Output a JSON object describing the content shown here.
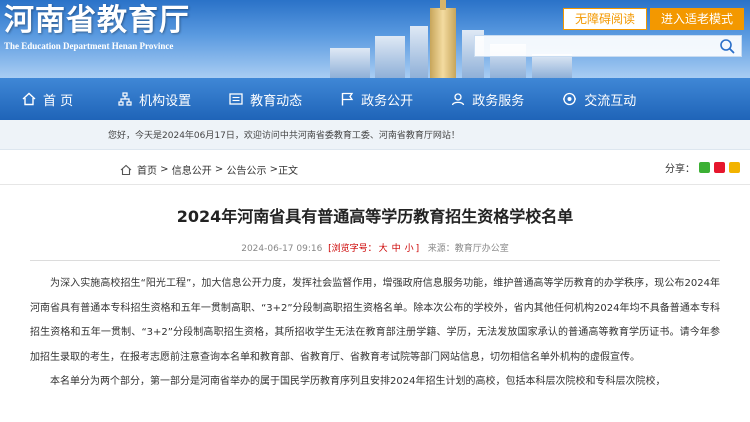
{
  "header": {
    "logo_cn": "河南省教育厅",
    "logo_en": "The Education Department Henan Province",
    "accessible_label": "无障碍阅读",
    "elder_label": "进入适老模式",
    "search_placeholder": ""
  },
  "nav": {
    "items": [
      {
        "label": "首 页",
        "icon": "home-icon"
      },
      {
        "label": "机构设置",
        "icon": "organization-icon"
      },
      {
        "label": "教育动态",
        "icon": "news-icon"
      },
      {
        "label": "政务公开",
        "icon": "flag-icon"
      },
      {
        "label": "政务服务",
        "icon": "service-icon"
      },
      {
        "label": "交流互动",
        "icon": "chat-icon"
      }
    ]
  },
  "welcome": {
    "prefix": "您好，今天是",
    "date": "2024年06月17日",
    "suffix": "，欢迎访问中共河南省委教育工委、河南省教育厅网站！"
  },
  "breadcrumb": {
    "items": [
      "首页",
      "信息公开",
      "公告公示",
      "正文"
    ],
    "share_label": "分享："
  },
  "article": {
    "title": "2024年河南省具有普通高等学历教育招生资格学校名单",
    "date": "2024-06-17 09:16",
    "views_label": "[浏览字号：",
    "size_large": "大",
    "size_medium": "中",
    "size_small": "小",
    "views_close": "]",
    "source": "来源：教育厅办公室",
    "paragraphs": [
      "为深入实施高校招生“阳光工程”，加大信息公开力度，发挥社会监督作用，增强政府信息服务功能，维护普通高等学历教育的办学秩序，现公布2024年河南省具有普通本专科招生资格和五年一贯制高职、“3+2”分段制高职招生资格名单。除本次公布的学校外，省内其他任何机构2024年均不具备普通本专科招生资格和五年一贯制、“3+2”分段制高职招生资格，其所招收学生无法在教育部注册学籍、学历，无法发放国家承认的普通高等教育学历证书。请今年参加招生录取的考生，在报考志愿前注意查询本名单和教育部、省教育厅、省教育考试院等部门网站信息，切勿相信名单外机构的虚假宣传。",
      "本名单分为两个部分，第一部分是河南省举办的属于国民学历教育序列且安排2024年招生计划的高校，包括本科层次院校和专科层次院校，"
    ]
  },
  "colors": {
    "nav_blue": "#1f64b8",
    "accent_orange": "#f39800",
    "highlight_red": "#cc0000"
  }
}
